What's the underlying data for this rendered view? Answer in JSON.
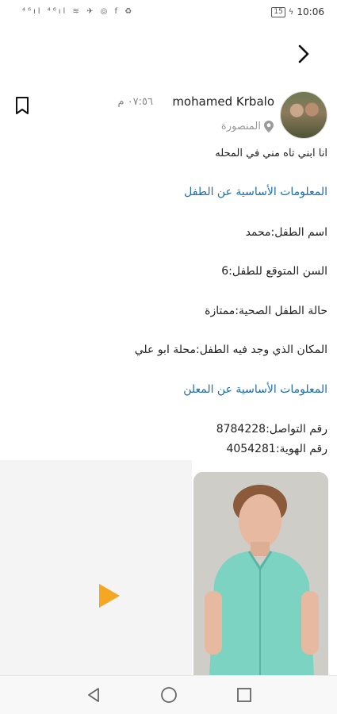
{
  "status_bar": {
    "left_icons": "⁴⁶ıl ⁴⁶ıl ≋ ✈ ◎ f ♻",
    "battery": "15",
    "time": "10:06"
  },
  "post": {
    "username": "mohamed Krbalo",
    "time": "٠٧:٥٦ م",
    "location": "المنصورة",
    "description": "انا ابني تاه مني في المحله"
  },
  "child_info": {
    "title": "المعلومات الأساسية عن الطفل",
    "name": "اسم الطفل:محمد",
    "age": "السن المتوقع للطفل:6",
    "health": "حالة الطفل الصحية:ممتازة",
    "place": "المكان الذي وجد فيه الطفل:محلة ابو علي"
  },
  "advertiser_info": {
    "title": "المعلومات الأساسية عن المعلن",
    "phone": "رقم التواصل:8784228",
    "id": "رقم الهوية:4054281"
  },
  "colors": {
    "accent": "#1d6fa8",
    "play": "#f5a623"
  },
  "icons": [
    "back-arrow-icon",
    "bookmark-icon",
    "location-pin-icon",
    "play-icon",
    "nav-back-icon",
    "nav-home-icon",
    "nav-recents-icon"
  ]
}
